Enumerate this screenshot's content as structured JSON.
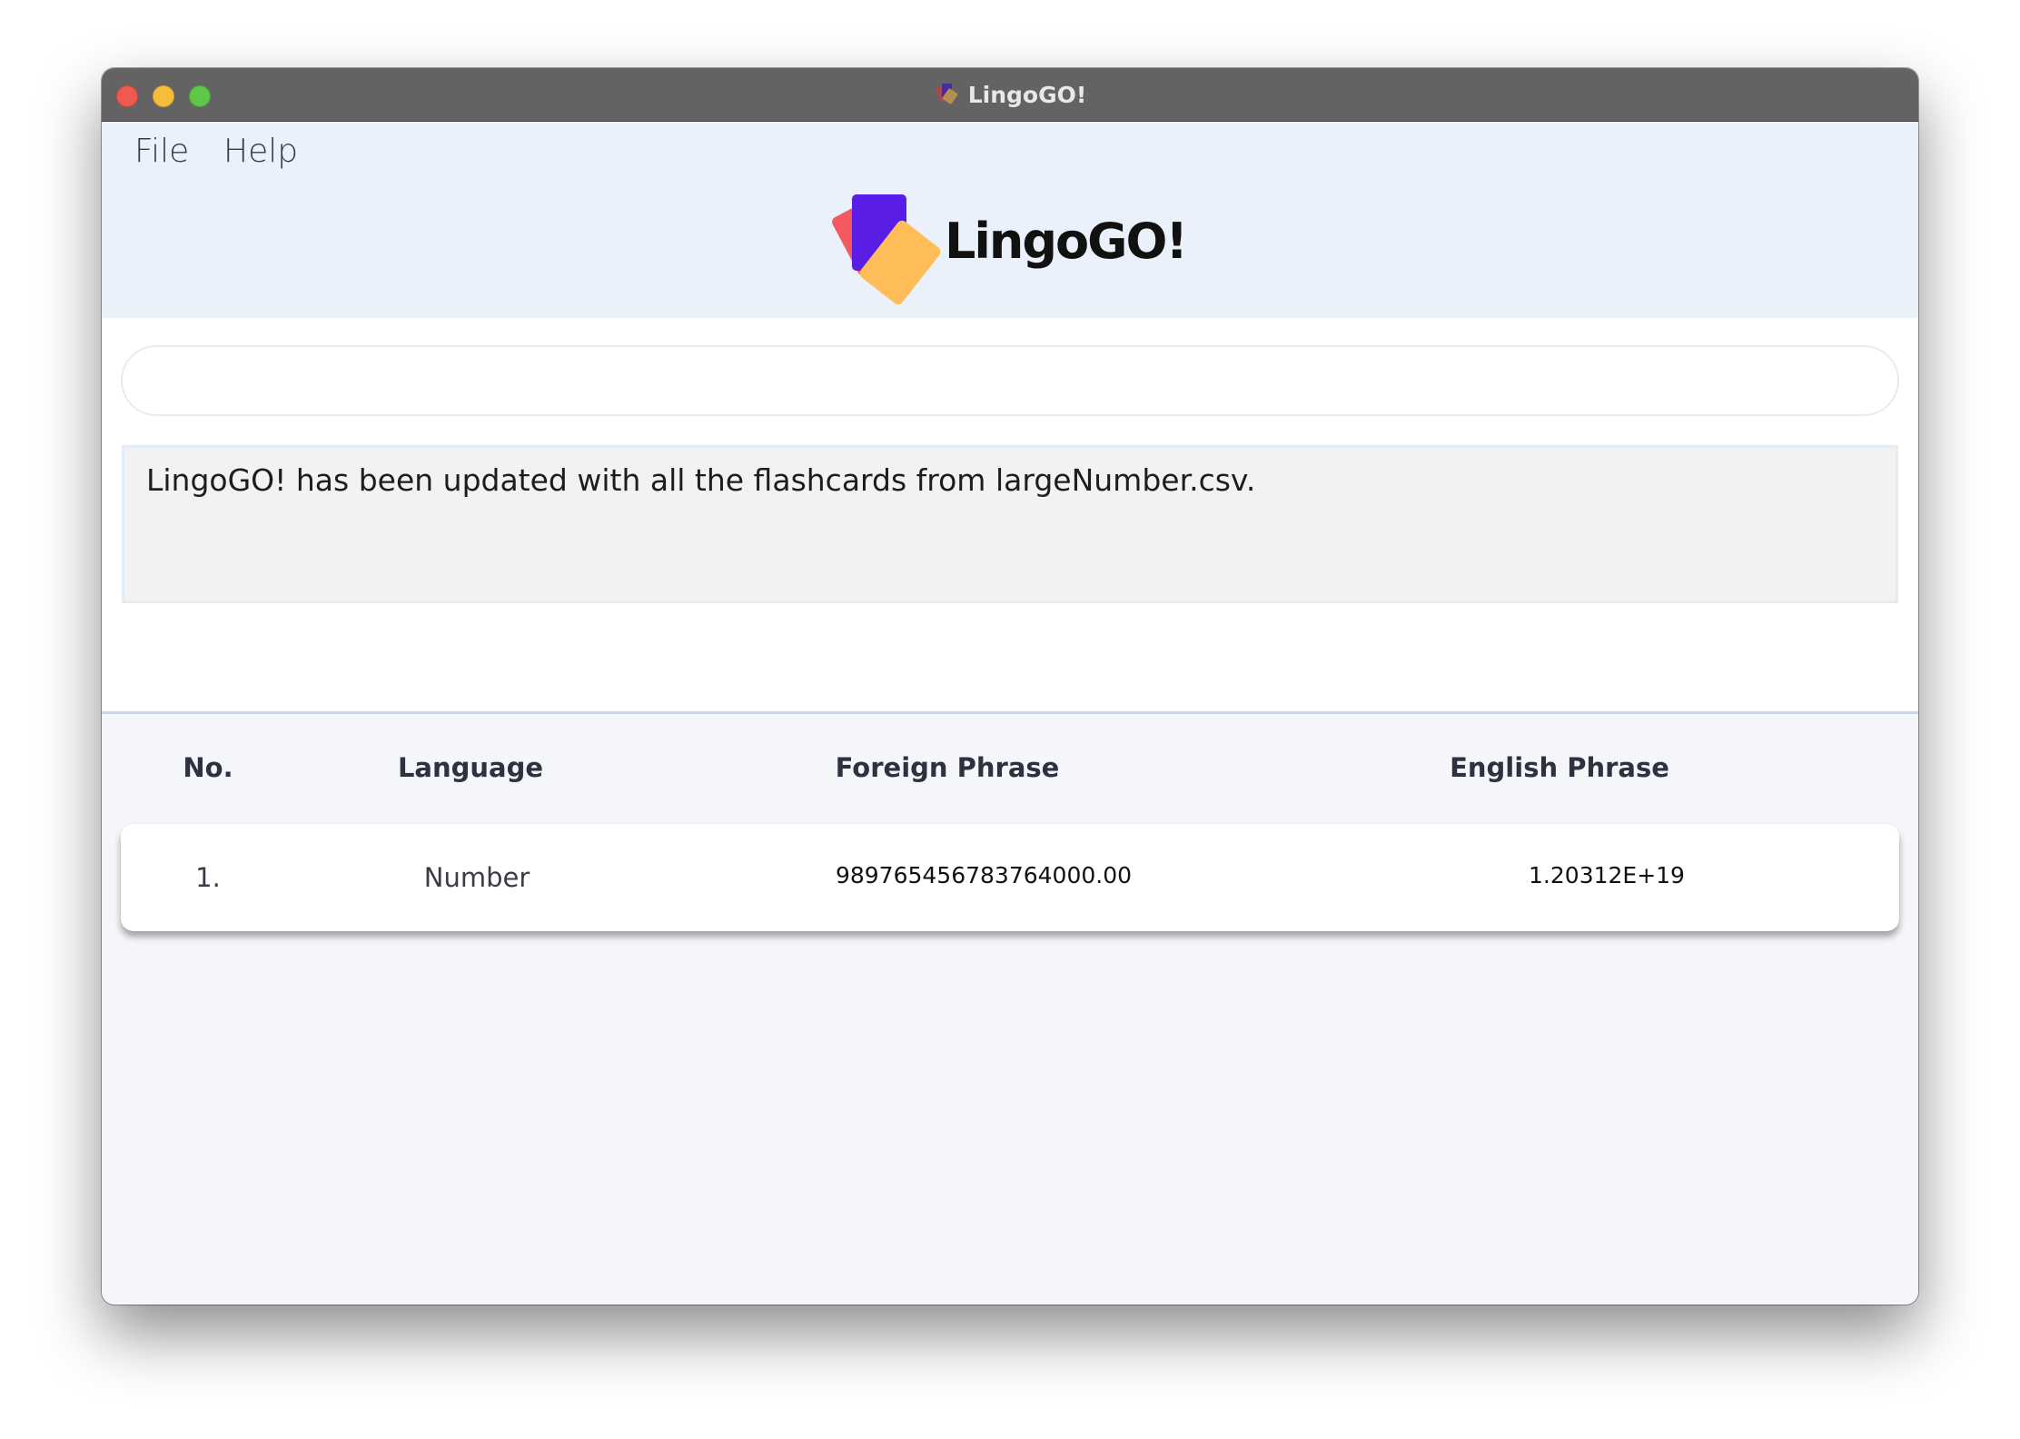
{
  "window": {
    "title": "LingoGO!"
  },
  "menu": {
    "file": "File",
    "help": "Help"
  },
  "logo": {
    "text": "LingoGO!",
    "colors": {
      "red_card": "#f4595f",
      "purple_card": "#5a1de6",
      "orange_card": "#ffbd59"
    }
  },
  "command": {
    "value": "",
    "placeholder": ""
  },
  "result": {
    "message": "LingoGO! has been updated with all the flashcards from largeNumber.csv."
  },
  "table": {
    "headers": {
      "no": "No.",
      "language": "Language",
      "foreign": "Foreign Phrase",
      "english": "English Phrase"
    },
    "rows": [
      {
        "no": "1.",
        "language": "Number",
        "foreign": "989765456783764000.00",
        "english": "1.20312E+19"
      }
    ]
  }
}
